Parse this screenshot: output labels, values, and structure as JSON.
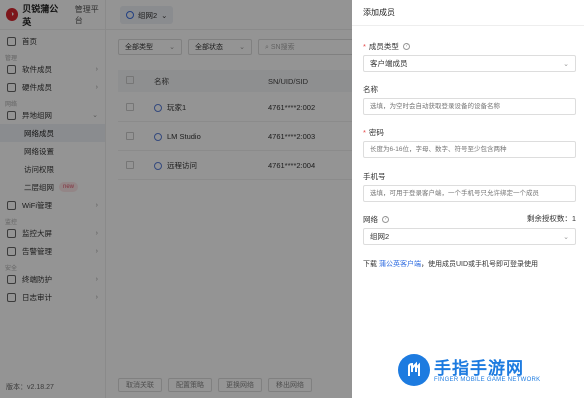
{
  "brand": {
    "name": "贝锐蒲公英",
    "subtitle": "管理平台"
  },
  "topbar": {
    "network": "组网2"
  },
  "sidebar": {
    "home": "首页",
    "sections": {
      "manage": "管理",
      "network": "网络",
      "monitor": "监控",
      "security": "安全"
    },
    "software_members": "软件成员",
    "hardware_members": "硬件成员",
    "remote_network": "异地组网",
    "sub": {
      "network_members": "网络成员",
      "network_settings": "网络设置",
      "access_rights": "访问权限",
      "layer2": "二层组网",
      "layer2_badge": "new"
    },
    "wifi": "WiFi管理",
    "monitor_screen": "监控大屏",
    "alarm": "告警管理",
    "terminal": "终端防护",
    "log_audit": "日志审计",
    "version": "版本：v2.18.27"
  },
  "main": {
    "filters": {
      "type": "全部类型",
      "status": "全部状态",
      "search_placeholder": "SN搜索"
    },
    "columns": {
      "name": "名称",
      "sn": "SN/UID/SID"
    },
    "rows": [
      {
        "name": "玩家1",
        "sn": "4761****2:002"
      },
      {
        "name": "LM Studio",
        "sn": "4761****2:003"
      },
      {
        "name": "远程访问",
        "sn": "4761****2:004"
      }
    ],
    "bottom_buttons": [
      "取消关联",
      "配置策略",
      "更换网络",
      "移出网络"
    ]
  },
  "drawer": {
    "title": "添加成员",
    "member_type_label": "成员类型",
    "member_type_value": "客户端成员",
    "name_label": "名称",
    "name_placeholder": "选填，为空时会自动获取登录设备的设备名称",
    "password_label": "密码",
    "password_placeholder": "长度为6-16位，字母、数字、符号至少包含两种",
    "phone_label": "手机号",
    "phone_placeholder": "选填，可用于登录客户端，一个手机号只允许绑定一个成员",
    "network_label": "网络",
    "remaining_label": "剩余授权数：",
    "remaining_value": "1",
    "network_value": "组网2",
    "note_prefix": "下载",
    "note_link": "蒲公英客户端",
    "note_suffix": "，使用成员UID或手机号即可登录使用"
  },
  "watermark": {
    "title": "手指手游网",
    "subtitle": "FINGER MOBILE GAME NETWORK"
  },
  "colors": {
    "accent": "#2f6de1",
    "required": "#e54545",
    "brand_red": "#d8262f"
  }
}
